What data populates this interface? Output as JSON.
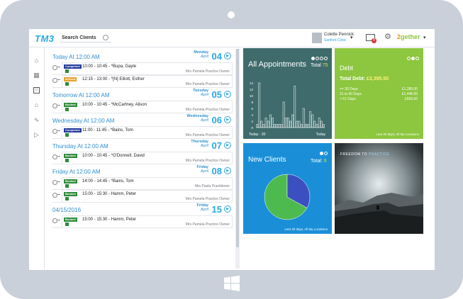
{
  "topbar": {
    "logo": "TM3",
    "search_placeholder": "Search Clients",
    "user_name": "Colette Pennick",
    "user_location": "Sanford Clinic",
    "mail_badge": "8",
    "brand_a": "2",
    "brand_b": "gether"
  },
  "nav": {
    "items": [
      "home-icon",
      "calendar-icon",
      "clients-icon",
      "ledger-icon",
      "reports-icon",
      "send-icon"
    ]
  },
  "agenda": {
    "days": [
      {
        "title": "Today At 12:00 AM",
        "weekday": "Monday",
        "month": "April",
        "day": "04",
        "appointments": [
          {
            "status": "Completed",
            "status_type": "completed",
            "text": "10:00 - 10:45 - *Bupa, Gayle",
            "practitioner": "Mrs Pamela Practice Owner"
          },
          {
            "status": "Arrived",
            "status_type": "arrived",
            "text": "12:15 - 13:00 - *[N] Elliott, Esther",
            "practitioner": "Mrs Pamela Practice Owner"
          }
        ]
      },
      {
        "title": "Tomorrow At 12:00 AM",
        "weekday": "Tuesday",
        "month": "April",
        "day": "05",
        "appointments": [
          {
            "status": "Booked",
            "status_type": "booked",
            "text": "10:00 - 10:45 - *McCartney, Alison",
            "practitioner": "Mrs Pamela Practice Owner"
          }
        ]
      },
      {
        "title": "Wednesday At 12:00 AM",
        "weekday": "Wednesday",
        "month": "April",
        "day": "06",
        "appointments": [
          {
            "status": "Completed",
            "status_type": "completed",
            "text": "11:00 - 11:45 - *Bains, Tom",
            "practitioner": "Mrs Pamela Practice Owner"
          }
        ]
      },
      {
        "title": "Thursday At 12:00 AM",
        "weekday": "Thursday",
        "month": "April",
        "day": "07",
        "appointments": [
          {
            "status": "Booked",
            "status_type": "booked",
            "text": "10:00 - 10:45 - *O'Donnell, David",
            "practitioner": "Mrs Pamela Practice Owner"
          }
        ]
      },
      {
        "title": "Friday At 12:00 AM",
        "weekday": "Friday",
        "month": "April",
        "day": "08",
        "appointments": [
          {
            "status": "Booked",
            "status_type": "booked",
            "text": "14:00 - 14:45 - *Bains, Tom",
            "practitioner": "Mrs Paula Practitioner"
          },
          {
            "status": "Booked",
            "status_type": "booked",
            "text": "15:00 - 15:30 - Hamm, Peter",
            "practitioner": "Mrs Pamela Practice Owner"
          }
        ]
      },
      {
        "title": "04/15/2016",
        "weekday": "Friday",
        "month": "April",
        "day": "15",
        "appointments": [
          {
            "status": "Booked",
            "status_type": "booked",
            "text": "15:00 - 15:30 - Hamm, Peter",
            "practitioner": "Mrs Pamela Practice Owner"
          }
        ]
      }
    ]
  },
  "tiles": {
    "appointments": {
      "title": "All Appointments",
      "total_label": "Total",
      "total_value": "75",
      "x_start": "Today - 30",
      "x_end": "Today",
      "accent": "#c8e64a"
    },
    "debt": {
      "title": "Debt",
      "total_label": "Total Debt:",
      "total_value": "£3,395.50",
      "rows": [
        {
          "label": "<= 30 Days",
          "value": "£1,280.00"
        },
        {
          "label": "31 to 60 Days",
          "value": "£1,446.00"
        },
        {
          "label": "> 61 Days",
          "value": "£669.50"
        }
      ],
      "footer": "Last 30 days, All My Locations"
    },
    "clients": {
      "title": "New Clients",
      "total_label": "Total:",
      "total_value": "6",
      "footer": "Last 30 days, All My Locations"
    },
    "photo": {
      "caption_a": "FREEDOM TO ",
      "caption_b": "PRACTICE"
    }
  },
  "chart_data": [
    {
      "type": "bar",
      "ylim": [
        0,
        16
      ],
      "yticks": [
        0,
        2,
        4,
        6,
        8,
        10,
        12,
        14
      ],
      "xlabel_start": "Today - 30",
      "xlabel_end": "Today",
      "values": [
        1,
        14,
        2,
        1,
        3,
        2,
        4,
        3,
        1,
        1,
        1,
        1,
        8,
        3,
        3,
        2,
        4,
        13,
        2,
        2,
        1,
        6,
        1,
        1,
        5,
        4,
        2,
        1,
        3,
        2,
        1
      ]
    },
    {
      "type": "pie",
      "slices": [
        {
          "value": 67,
          "color": "#4cba4f"
        },
        {
          "value": 33,
          "color": "#3b4fbf"
        }
      ]
    }
  ]
}
